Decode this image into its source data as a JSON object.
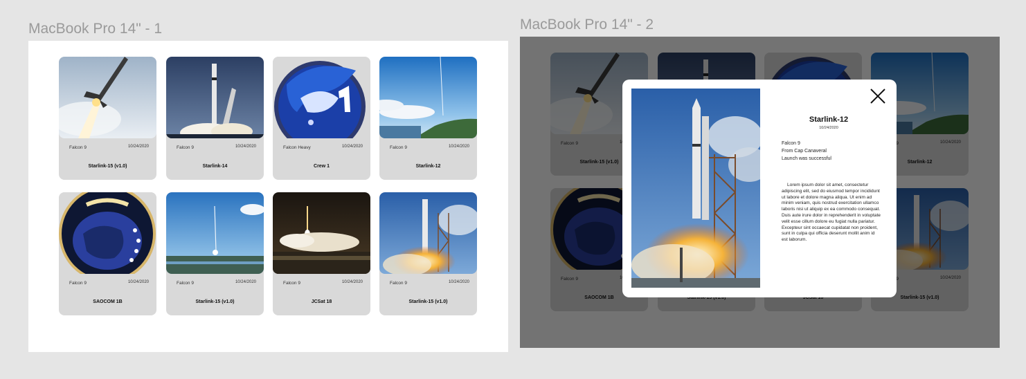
{
  "frames": [
    {
      "label": "MacBook Pro 14\" - 1"
    },
    {
      "label": "MacBook Pro 14\" - 2"
    }
  ],
  "cards": [
    {
      "rocket": "Falcon 9",
      "date": "10/24/2020",
      "name": "Starlink-15 (v1.0)"
    },
    {
      "rocket": "Falcon 9",
      "date": "10/24/2020",
      "name": "Starlink-14"
    },
    {
      "rocket": "Falcon Heavy",
      "date": "10/24/2020",
      "name": "Crew 1"
    },
    {
      "rocket": "Falcon 9",
      "date": "10/24/2020",
      "name": "Starlink-12"
    },
    {
      "rocket": "Falcon 9",
      "date": "10/24/2020",
      "name": "SAOCOM 1B"
    },
    {
      "rocket": "Falcon 9",
      "date": "10/24/2020",
      "name": "Starlink-15 (v1.0)"
    },
    {
      "rocket": "Falcon 9",
      "date": "10/24/2020",
      "name": "JCSat 18"
    },
    {
      "rocket": "Falcon 9",
      "date": "10/24/2020",
      "name": "Starlink-15 (v1.0)"
    }
  ],
  "modal": {
    "title": "Starlink-12",
    "date": "10/24/2020",
    "rocket": "Falcon 9",
    "launch_site": "From Cap Canaveral",
    "result": "Launch was successful",
    "description": "Lorem ipsum dolor sit amet, consectetur adipiscing elit, sed do eiusmod tempor incididunt ut labore et dolore magna aliqua. Ut enim ad minim veniam, quis nostrud exercitation ullamco laboris nisi ut aliquip ex ea commodo consequat. Duis aute irure dolor in reprehenderit in voluptate velit esse cillum dolore eu fugiat nulla pariatur. Excepteur sint occaecat cupidatat non proident, sunt in culpa qui officia deserunt mollit anim id est laborum.",
    "close_icon": "close-icon"
  },
  "thumb_icons": [
    "rocket-launch-photo",
    "rocket-launch-photo",
    "mission-patch-image",
    "coastline-launch-photo",
    "mission-patch-image",
    "launch-trail-photo",
    "night-launch-photo",
    "launchpad-photo"
  ],
  "colors": {
    "card_bg": "#d9d9d9",
    "canvas": "#e5e5e5",
    "overlay": "rgba(0,0,0,0.55)"
  }
}
